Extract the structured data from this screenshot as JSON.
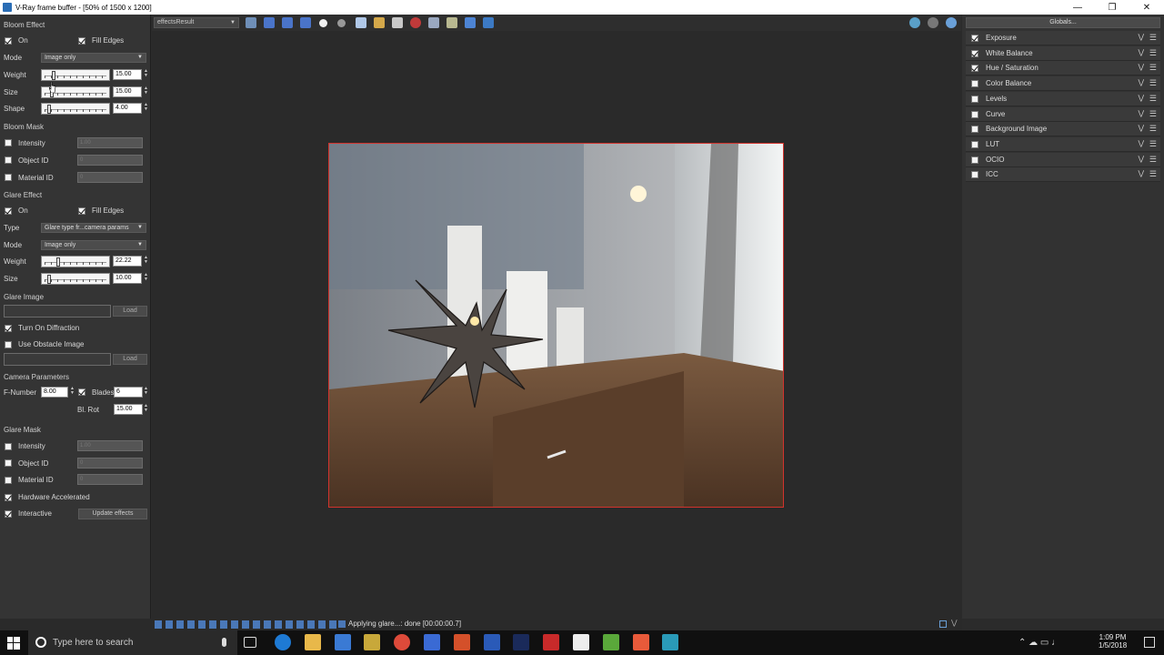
{
  "window": {
    "title": "V-Ray frame buffer - [50% of 1500 x 1200]"
  },
  "left": {
    "bloom_title": "Bloom Effect",
    "bloom_on": "On",
    "fill_edges": "Fill Edges",
    "mode_label": "Mode",
    "mode_value": "Image only",
    "weight_label": "Weight",
    "weight_value": "15.00",
    "size_label": "Size",
    "size_value": "15.00",
    "shape_label": "Shape",
    "shape_value": "4.00",
    "bloom_mask": "Bloom Mask",
    "intensity": "Intensity",
    "intensity_value": "1.00",
    "object_id": "Object ID",
    "object_id_value": "0",
    "material_id": "Material ID",
    "material_id_value": "0",
    "glare_title": "Glare Effect",
    "glare_on": "On",
    "glare_fill_edges": "Fill Edges",
    "type_label": "Type",
    "type_value": "Glare type fr...camera params",
    "glare_mode_label": "Mode",
    "glare_mode_value": "Image only",
    "glare_weight_label": "Weight",
    "glare_weight_value": "22.22",
    "glare_size_label": "Size",
    "glare_size_value": "10.00",
    "glare_image": "Glare Image",
    "load": "Load",
    "diffraction": "Turn On Diffraction",
    "obstacle": "Use Obstacle Image",
    "load2": "Load",
    "camera_params": "Camera Parameters",
    "fnumber_label": "F-Number",
    "fnumber_value": "8.00",
    "blades_label": "Blades",
    "blades_value": "6",
    "blrot_label": "Bl. Rot",
    "blrot_value": "15.00",
    "glare_mask": "Glare Mask",
    "g_intensity": "Intensity",
    "g_intensity_value": "1.00",
    "g_object_id": "Object ID",
    "g_object_id_value": "0",
    "g_material_id": "Material ID",
    "g_material_id_value": "0",
    "hw_accel": "Hardware Accelerated",
    "interactive": "Interactive",
    "update": "Update effects"
  },
  "toolbar": {
    "channel": "effectsResult"
  },
  "status": {
    "text": "Applying glare...: done [00:00:00.7]"
  },
  "right": {
    "globals": "Globals...",
    "layers": [
      "Exposure",
      "White Balance",
      "Hue / Saturation",
      "Color Balance",
      "Levels",
      "Curve",
      "Background Image",
      "LUT",
      "OCIO",
      "ICC"
    ]
  },
  "taskbar": {
    "search_placeholder": "Type here to search",
    "time": "1:09 PM",
    "date": "1/5/2018"
  }
}
